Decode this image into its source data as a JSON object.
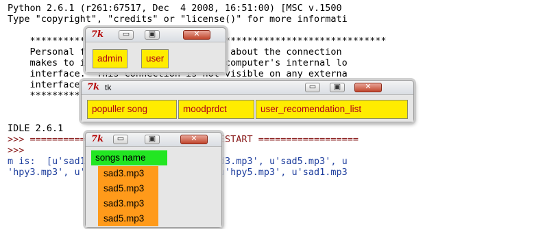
{
  "shell": {
    "lines": [
      "Python 2.6.1 (r261:67517, Dec  4 2008, 16:51:00) [MSC v.1500",
      "Type \"copyright\", \"credits\" or \"license()\" for more informati",
      "    ****************************************************************",
      "    Personal firewall software may warn about the connection",
      "    makes to its subprocess using this computer's internal lo",
      "    interface.  This connection is not visible on any externa",
      "    interface and no data is sent to or received from the Int",
      "    ****************************************************************",
      "IDLE 2.6.1",
      ">>> ================================ RESTART ==================",
      ">>>",
      "m is:  [u'sad1.mp3', u'sad5.mp3', u'sad3.mp3', u'sad5.mp3', u",
      "'hpy3.mp3', u'hpy4.mp3', u'hpy2.mp3', u'hpy5.mp3', u'sad1.mp3"
    ]
  },
  "window_login": {
    "logo": "7k",
    "buttons": [
      "admin",
      "user"
    ],
    "controls": {
      "minimize": "▭",
      "maximize": "▣",
      "close": "✕"
    }
  },
  "window_user": {
    "logo": "7k",
    "title": "tk",
    "buttons": [
      "populler song",
      "moodprdct",
      "user_recomendation_list"
    ],
    "controls": {
      "minimize": "▭",
      "maximize": "▣",
      "close": "✕"
    }
  },
  "window_songs": {
    "logo": "7k",
    "header": "songs name",
    "songs": [
      "sad3.mp3",
      "sad5.mp3",
      "sad3.mp3",
      "sad5.mp3"
    ],
    "controls": {
      "minimize": "▭",
      "maximize": "▣",
      "close": "✕"
    }
  },
  "colors": {
    "button_yellow": "#ffec00",
    "label_green": "#22e622",
    "song_orange": "#ff9a1a",
    "button_text": "#b0001a"
  }
}
